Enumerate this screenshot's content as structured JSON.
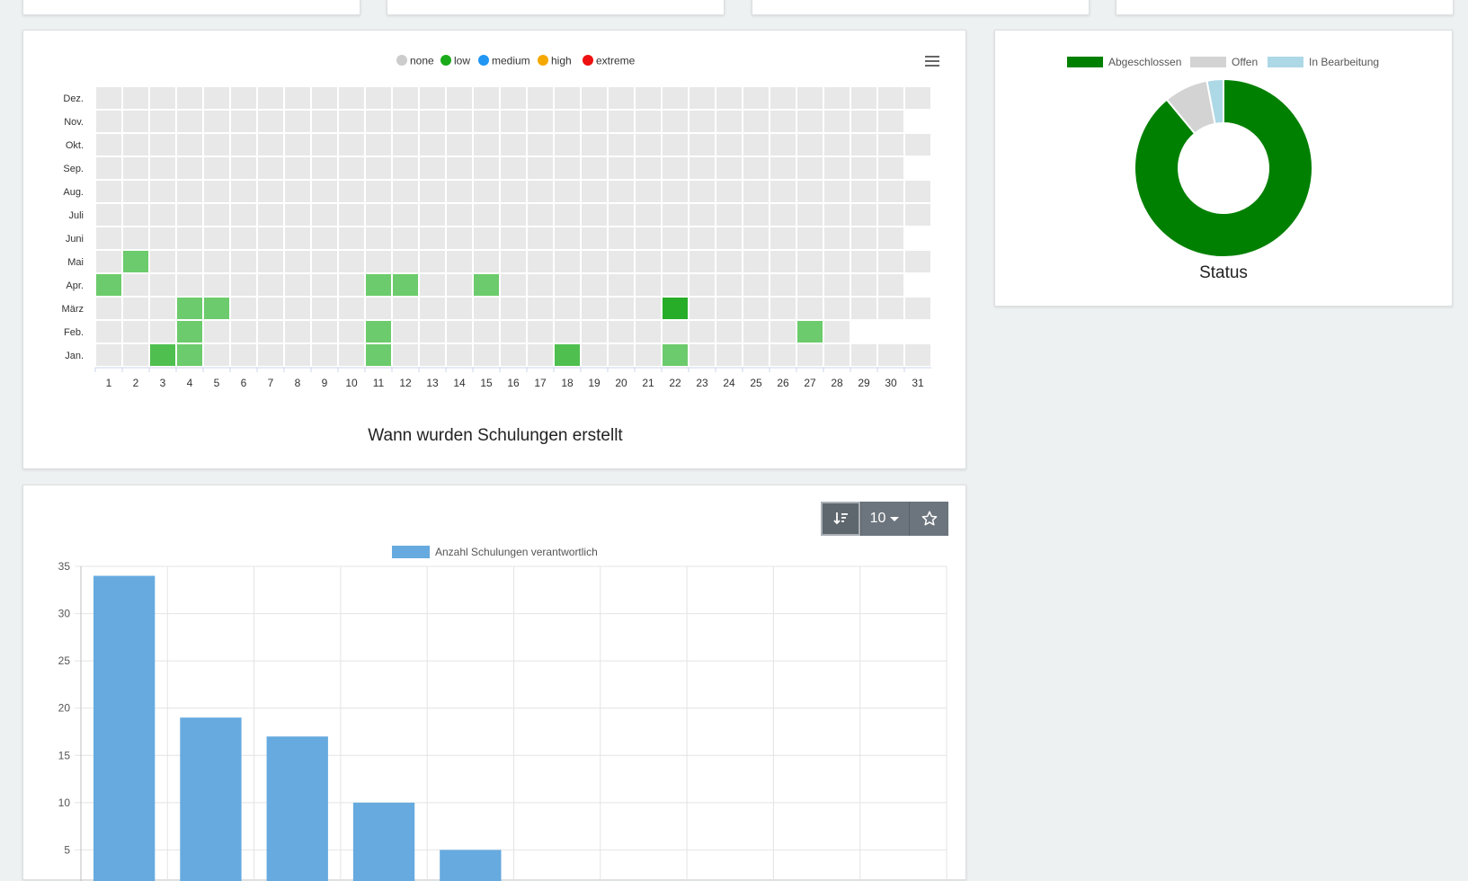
{
  "heatmap_card": {
    "chart_data": {
      "type": "heatmap",
      "title": "Wann wurden Schulungen erstellt",
      "legend": [
        {
          "label": "none",
          "color": "#cccccc"
        },
        {
          "label": "low",
          "color": "#1aab1a"
        },
        {
          "label": "medium",
          "color": "#2196f3"
        },
        {
          "label": "high",
          "color": "#f5a800"
        },
        {
          "label": "extreme",
          "color": "#ee1111"
        }
      ],
      "y_categories": [
        "Dez.",
        "Nov.",
        "Okt.",
        "Sep.",
        "Aug.",
        "Juli",
        "Juni",
        "Mai",
        "Apr.",
        "März",
        "Feb.",
        "Jan."
      ],
      "x_categories": [
        "1",
        "2",
        "3",
        "4",
        "5",
        "6",
        "7",
        "8",
        "9",
        "10",
        "11",
        "12",
        "13",
        "14",
        "15",
        "16",
        "17",
        "18",
        "19",
        "20",
        "21",
        "22",
        "23",
        "24",
        "25",
        "26",
        "27",
        "28",
        "29",
        "30",
        "31"
      ],
      "days_in_month": [
        31,
        30,
        31,
        30,
        31,
        31,
        30,
        31,
        30,
        31,
        28,
        31
      ],
      "cells": [
        {
          "month": "Mai",
          "day": 2,
          "level": 1
        },
        {
          "month": "Apr.",
          "day": 1,
          "level": 1
        },
        {
          "month": "Apr.",
          "day": 11,
          "level": 1
        },
        {
          "month": "Apr.",
          "day": 12,
          "level": 1
        },
        {
          "month": "Apr.",
          "day": 15,
          "level": 1
        },
        {
          "month": "März",
          "day": 4,
          "level": 1
        },
        {
          "month": "März",
          "day": 5,
          "level": 1
        },
        {
          "month": "März",
          "day": 22,
          "level": 3
        },
        {
          "month": "Feb.",
          "day": 4,
          "level": 1
        },
        {
          "month": "Feb.",
          "day": 11,
          "level": 1
        },
        {
          "month": "Feb.",
          "day": 27,
          "level": 1
        },
        {
          "month": "Jan.",
          "day": 3,
          "level": 2
        },
        {
          "month": "Jan.",
          "day": 4,
          "level": 1
        },
        {
          "month": "Jan.",
          "day": 11,
          "level": 1
        },
        {
          "month": "Jan.",
          "day": 18,
          "level": 2
        },
        {
          "month": "Jan.",
          "day": 22,
          "level": 1
        }
      ],
      "level_colors": [
        "#e8e8e8",
        "#6ccb6c",
        "#4fbf4f",
        "#27ad27"
      ],
      "menu_icon": "hamburger-menu-icon"
    }
  },
  "status_card": {
    "chart_data": {
      "type": "pie",
      "title": "Status",
      "legend_position": "top",
      "categories": [
        "Abgeschlossen",
        "Offen",
        "In Bearbeitung"
      ],
      "values": [
        89,
        8,
        3
      ],
      "colors": [
        "#008000",
        "#d3d3d3",
        "#add8e6"
      ]
    }
  },
  "bar_card": {
    "toolbar": {
      "sort_icon": "sort-descending-icon",
      "count_label": "10",
      "caret_icon": "caret-down-icon",
      "favorite_icon": "star-outline-icon"
    },
    "chart_data": {
      "type": "bar",
      "series": [
        {
          "name": "Anzahl Schulungen verantwortlich",
          "values": [
            34,
            19,
            17,
            10,
            5,
            0,
            0,
            0,
            0,
            0
          ],
          "color": "#66aadf"
        }
      ],
      "ylim": [
        0,
        35
      ],
      "yticks": [
        5,
        10,
        15,
        20,
        25,
        30,
        35
      ],
      "xlabel": "",
      "ylabel": "",
      "grid": true,
      "legend_position": "top"
    }
  }
}
